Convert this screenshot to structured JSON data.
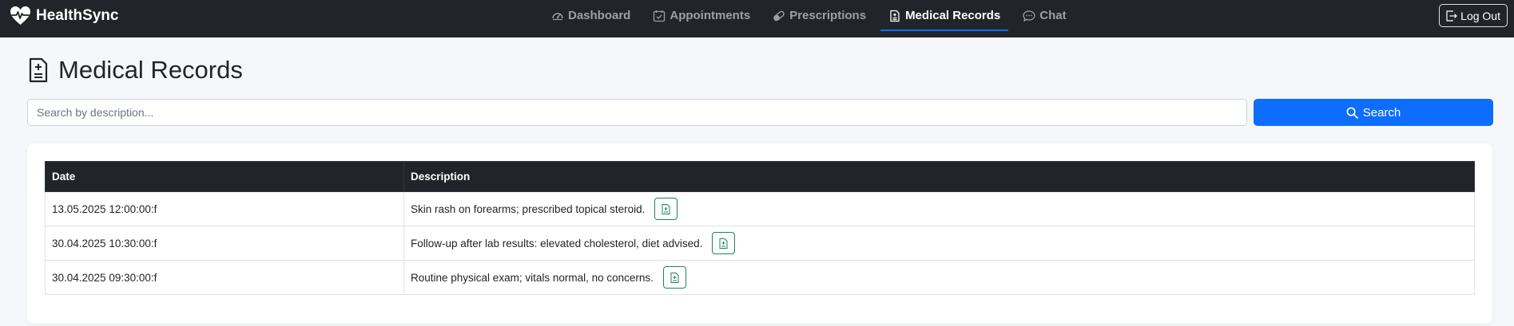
{
  "navbar": {
    "brand": "HealthSync",
    "links": [
      {
        "label": "Dashboard",
        "icon": "speedometer-icon"
      },
      {
        "label": "Appointments",
        "icon": "calendar-check-icon"
      },
      {
        "label": "Prescriptions",
        "icon": "capsule-icon"
      },
      {
        "label": "Medical Records",
        "icon": "file-medical-icon",
        "active": true
      },
      {
        "label": "Chat",
        "icon": "chat-dots-icon"
      }
    ],
    "logout_label": "Log Out"
  },
  "page": {
    "title": "Medical Records"
  },
  "search": {
    "placeholder": "Search by description...",
    "value": "",
    "button_label": "Search"
  },
  "table": {
    "headers": [
      "Date",
      "Description"
    ],
    "rows": [
      {
        "date": "13.05.2025 12:00:00:f",
        "description": "Skin rash on forearms; prescribed topical steroid."
      },
      {
        "date": "30.04.2025 10:30:00:f",
        "description": "Follow-up after lab results: elevated cholesterol, diet advised."
      },
      {
        "date": "30.04.2025 09:30:00:f",
        "description": "Routine physical exam; vitals normal, no concerns."
      }
    ]
  },
  "colors": {
    "navbar_bg": "#212529",
    "primary": "#0d6efd",
    "success_outline": "#198754",
    "page_bg": "#f5f7fa"
  }
}
